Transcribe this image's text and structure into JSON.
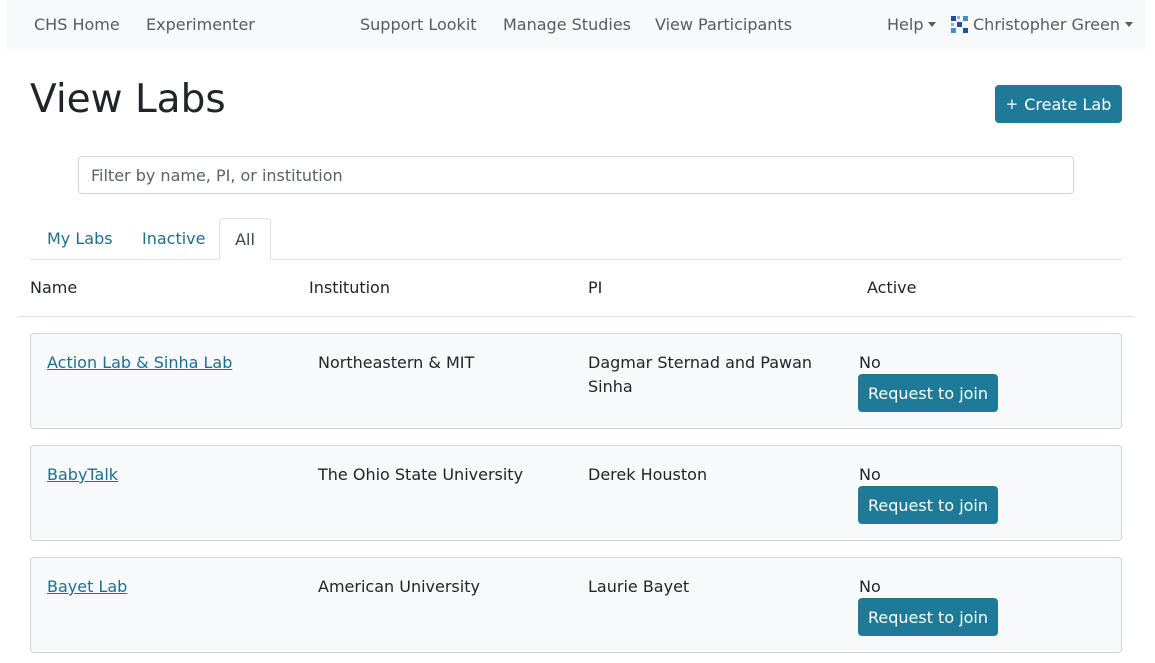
{
  "nav": {
    "home": "CHS Home",
    "experimenter": "Experimenter",
    "support": "Support Lookit",
    "manage_studies": "Manage Studies",
    "view_participants": "View Participants",
    "help": "Help",
    "user": "Christopher Green"
  },
  "page": {
    "title": "View Labs",
    "create_label": "Create Lab",
    "create_icon": "plus-icon"
  },
  "filter": {
    "placeholder": "Filter by name, PI, or institution",
    "value": ""
  },
  "tabs": [
    {
      "label": "My Labs",
      "active": false
    },
    {
      "label": "Inactive",
      "active": false
    },
    {
      "label": "All",
      "active": true
    }
  ],
  "columns": [
    "Name",
    "Institution",
    "PI",
    "Active"
  ],
  "labs": [
    {
      "name": "Action Lab & Sinha Lab",
      "institution": "Northeastern & MIT",
      "pi": "Dagmar Sternad and Pawan Sinha",
      "active": "No",
      "action": "Request to join"
    },
    {
      "name": "BabyTalk",
      "institution": "The Ohio State University",
      "pi": "Derek Houston",
      "active": "No",
      "action": "Request to join"
    },
    {
      "name": "Bayet Lab",
      "institution": "American University",
      "pi": "Laurie Bayet",
      "active": "No",
      "action": "Request to join"
    }
  ],
  "colors": {
    "primary": "#1e7a96",
    "link": "#1e6e8f",
    "navbar_bg": "#f8f9fa",
    "card_bg": "#f8f9fa"
  }
}
